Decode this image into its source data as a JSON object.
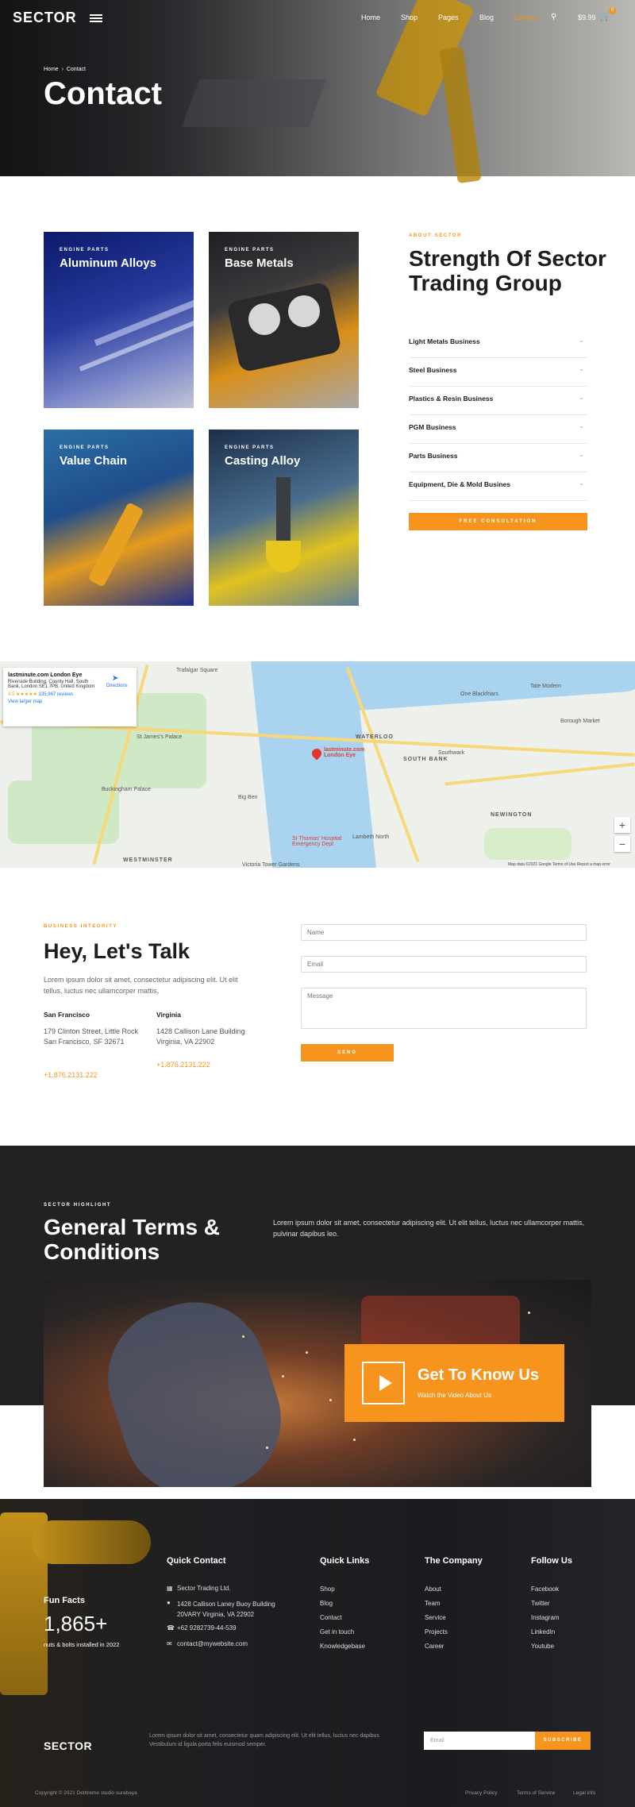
{
  "nav": {
    "logo": "SECTOR",
    "links": [
      "Home",
      "Shop",
      "Pages",
      "Blog",
      "Contact"
    ],
    "active": "Contact",
    "cart_total": "$9.99",
    "cart_count": "0"
  },
  "hero": {
    "breadcrumb_home": "Home",
    "breadcrumb_sep": "›",
    "breadcrumb_current": "Contact",
    "title": "Contact"
  },
  "cards": [
    {
      "eyebrow": "ENGINE PARTS",
      "title": "Aluminum Alloys"
    },
    {
      "eyebrow": "ENGINE PARTS",
      "title": "Base Metals"
    },
    {
      "eyebrow": "ENGINE PARTS",
      "title": "Value Chain"
    },
    {
      "eyebrow": "ENGINE PARTS",
      "title": "Casting Alloy"
    }
  ],
  "about": {
    "eyebrow": "ABOUT SECTOR",
    "title": "Strength Of Sector Trading Group",
    "accordion": [
      "Light Metals Business",
      "Steel Business",
      "Plastics & Resin Business",
      "PGM Business",
      "Parts Business",
      "Equipment, Die & Mold Busines"
    ],
    "button": "FREE CONSULTATION"
  },
  "map": {
    "place_name": "lastminute.com London Eye",
    "address": "Riverside Building, County Hall, South Bank, London SE1 7PB, United Kingdom",
    "rating": "4.5 ★★★★★",
    "reviews": "135,967 reviews",
    "directions": "Directions",
    "larger_map": "View larger map",
    "labels": [
      "Trafalgar Square",
      "St James's Palace",
      "Buckingham Palace",
      "WATERLOO",
      "SOUTH BANK",
      "Southwark",
      "NEWINGTON",
      "WESTMINSTER",
      "Big Ben",
      "Borough Market",
      "One Blackfriars",
      "Tate Modern",
      "St Thomas' Hospital Emergency Dept",
      "Lambeth North",
      "Victoria Tower Gardens"
    ],
    "pin_label": "lastminute.com London Eye",
    "attribution": "Map data ©2021 Google   Terms of Use   Report a map error"
  },
  "contact": {
    "eyebrow": "BUSINESS INTEGRITY",
    "title": "Hey, Let's Talk",
    "description": "Lorem ipsum dolor sit amet, consectetur adipiscing elit. Ut elit tellus, luctus nec ullamcorper mattis,",
    "offices": [
      {
        "city": "San Francisco",
        "address": "179  Clinton Street, Little Rock\nSan Francisco, SF 32671",
        "phone": "+1.876.2131.222"
      },
      {
        "city": "Virginia",
        "address": "1428 Callison Lane Building\nVirginia, VA 22902",
        "phone": "+1.876.2131.222"
      }
    ],
    "form": {
      "name_ph": "Name",
      "email_ph": "Email",
      "message_ph": "Message",
      "send": "SEND"
    }
  },
  "terms": {
    "eyebrow": "SECTOR HIGHLIGHT",
    "title": "General Terms & Conditions",
    "description": "Lorem ipsum dolor sit amet, consectetur adipiscing elit. Ut elit tellus, luctus nec ullamcorper mattis, pulvinar dapibus leo.",
    "video_title": "Get To Know Us",
    "video_sub": "Watch the Video About Us"
  },
  "footer": {
    "fun_title": "Fun Facts",
    "fun_number": "1,865+",
    "fun_desc": "nuts & bolts installed in 2022",
    "quick_contact_title": "Quick Contact",
    "contact_items": [
      "Sector Trading Ltd.",
      "1428 Callison Laney Buoy Building 20VARY Virginia, VA 22902",
      "+62 9282739-44-539",
      "contact@mywebsite.com"
    ],
    "quick_links_title": "Quick Links",
    "quick_links": [
      "Shop",
      "Blog",
      "Contact",
      "Get in touch",
      "Knowledgebase"
    ],
    "company_title": "The Company",
    "company_links": [
      "About",
      "Team",
      "Service",
      "Projects",
      "Career"
    ],
    "follow_title": "Follow Us",
    "follow_links": [
      "Facebook",
      "Twitter",
      "Instagram",
      "LinkedIn",
      "Youtube"
    ],
    "logo": "SECTOR",
    "description": "Lorem ipsum dolor sit amet, consectetur quam adipiscing elit. Ut elit tellus, luctus nec dapibus Vestibulum id ligula porta felis euismod semper.",
    "email_ph": "Email",
    "subscribe": "SUBSCRIBE",
    "copyright": "Copyright © 2021 Dethreme studio surabaya",
    "legal": [
      "Privacy Policy",
      "Terms of Service",
      "Legal info"
    ]
  },
  "colors": {
    "accent": "#f7941d",
    "dark": "#222222"
  }
}
